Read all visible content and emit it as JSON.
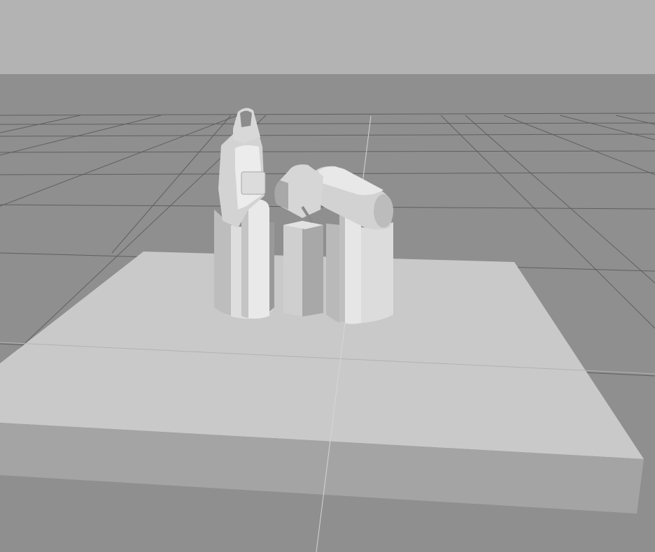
{
  "scene": {
    "colors": {
      "sky": "#b3b3b3",
      "floor": "#8f8f8f",
      "grid_line": "#5c5c5c",
      "axis_line": "#d0d0d0",
      "platform_top": "#c8c8c8",
      "platform_front": "#a3a3a3",
      "platform_edge": "#b5b5b5",
      "robot_light": "#e6e6e6",
      "robot_mid": "#cfcfcf",
      "robot_dark": "#9d9d9d",
      "robot_shadow": "#7d7d7d"
    },
    "objects": {
      "robot_count": 2,
      "center_pedestal": true,
      "grid_visible": true
    }
  }
}
